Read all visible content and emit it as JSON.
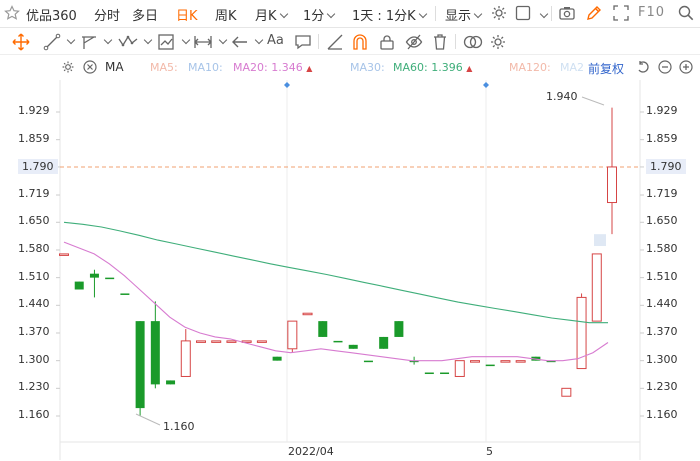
{
  "toolbar": {
    "stock_name": "优品360",
    "tabs": [
      "分时",
      "多日",
      "日K",
      "周K",
      "月K"
    ],
    "active_tab": "日K",
    "period": "1分",
    "range": "1天 : 1分K",
    "display": "显示",
    "f10": "F10"
  },
  "ma_legend": {
    "label": "MA",
    "ma5": "MA5:",
    "ma10": "MA10:",
    "ma20": "MA20: 1.346",
    "ma30": "MA30:",
    "ma60": "MA60: 1.396",
    "ma120": "MA120:",
    "ma250": "MA2",
    "adjust": "前复权"
  },
  "colors": {
    "up": "#d64545",
    "down": "#1a9a2a",
    "ma20": "#d77bd0",
    "ma60": "#3fae7a",
    "ma_faded": "#f2b9a9",
    "ma_blue": "#a7c4e8",
    "accent": "#ff6a00"
  },
  "chart_data": {
    "type": "candlestick",
    "y_ticks": [
      "1.929",
      "1.859",
      "1.790",
      "1.719",
      "1.650",
      "1.580",
      "1.510",
      "1.440",
      "1.370",
      "1.300",
      "1.230",
      "1.160"
    ],
    "current_price": "1.790",
    "ylim": [
      1.12,
      1.97
    ],
    "x_labels": [
      "2022/04",
      "5"
    ],
    "max_label": "1.940",
    "min_label": "1.160",
    "candles": [
      {
        "o": 1.57,
        "h": 1.57,
        "l": 1.57,
        "c": 1.57,
        "dir": "up"
      },
      {
        "o": 1.5,
        "h": 1.5,
        "l": 1.48,
        "c": 1.48,
        "dir": "down"
      },
      {
        "o": 1.52,
        "h": 1.53,
        "l": 1.46,
        "c": 1.51,
        "dir": "down"
      },
      {
        "o": 1.51,
        "h": 1.51,
        "l": 1.51,
        "c": 1.51,
        "dir": "down"
      },
      {
        "o": 1.47,
        "h": 1.47,
        "l": 1.47,
        "c": 1.47,
        "dir": "down"
      },
      {
        "o": 1.4,
        "h": 1.4,
        "l": 1.16,
        "c": 1.18,
        "dir": "down"
      },
      {
        "o": 1.4,
        "h": 1.45,
        "l": 1.23,
        "c": 1.24,
        "dir": "down"
      },
      {
        "o": 1.25,
        "h": 1.25,
        "l": 1.24,
        "c": 1.24,
        "dir": "down"
      },
      {
        "o": 1.26,
        "h": 1.38,
        "l": 1.26,
        "c": 1.35,
        "dir": "up"
      },
      {
        "o": 1.35,
        "h": 1.35,
        "l": 1.35,
        "c": 1.35,
        "dir": "up"
      },
      {
        "o": 1.35,
        "h": 1.35,
        "l": 1.35,
        "c": 1.35,
        "dir": "up"
      },
      {
        "o": 1.35,
        "h": 1.35,
        "l": 1.35,
        "c": 1.35,
        "dir": "up"
      },
      {
        "o": 1.35,
        "h": 1.35,
        "l": 1.35,
        "c": 1.35,
        "dir": "up"
      },
      {
        "o": 1.35,
        "h": 1.35,
        "l": 1.35,
        "c": 1.35,
        "dir": "up"
      },
      {
        "o": 1.31,
        "h": 1.31,
        "l": 1.3,
        "c": 1.3,
        "dir": "down"
      },
      {
        "o": 1.33,
        "h": 1.4,
        "l": 1.32,
        "c": 1.4,
        "dir": "up"
      },
      {
        "o": 1.42,
        "h": 1.42,
        "l": 1.42,
        "c": 1.42,
        "dir": "up"
      },
      {
        "o": 1.4,
        "h": 1.4,
        "l": 1.36,
        "c": 1.36,
        "dir": "down"
      },
      {
        "o": 1.35,
        "h": 1.35,
        "l": 1.35,
        "c": 1.35,
        "dir": "down"
      },
      {
        "o": 1.34,
        "h": 1.34,
        "l": 1.33,
        "c": 1.33,
        "dir": "down"
      },
      {
        "o": 1.3,
        "h": 1.3,
        "l": 1.3,
        "c": 1.3,
        "dir": "down"
      },
      {
        "o": 1.36,
        "h": 1.36,
        "l": 1.33,
        "c": 1.33,
        "dir": "down"
      },
      {
        "o": 1.4,
        "h": 1.4,
        "l": 1.36,
        "c": 1.36,
        "dir": "down"
      },
      {
        "o": 1.3,
        "h": 1.31,
        "l": 1.29,
        "c": 1.3,
        "dir": "down"
      },
      {
        "o": 1.27,
        "h": 1.27,
        "l": 1.27,
        "c": 1.27,
        "dir": "down"
      },
      {
        "o": 1.27,
        "h": 1.27,
        "l": 1.27,
        "c": 1.27,
        "dir": "down"
      },
      {
        "o": 1.26,
        "h": 1.3,
        "l": 1.26,
        "c": 1.3,
        "dir": "up"
      },
      {
        "o": 1.3,
        "h": 1.3,
        "l": 1.3,
        "c": 1.3,
        "dir": "up"
      },
      {
        "o": 1.29,
        "h": 1.29,
        "l": 1.29,
        "c": 1.29,
        "dir": "down"
      },
      {
        "o": 1.3,
        "h": 1.3,
        "l": 1.3,
        "c": 1.3,
        "dir": "up"
      },
      {
        "o": 1.3,
        "h": 1.3,
        "l": 1.3,
        "c": 1.3,
        "dir": "up"
      },
      {
        "o": 1.31,
        "h": 1.31,
        "l": 1.3,
        "c": 1.3,
        "dir": "down"
      },
      {
        "o": 1.3,
        "h": 1.3,
        "l": 1.3,
        "c": 1.3,
        "dir": "down"
      },
      {
        "o": 1.21,
        "h": 1.23,
        "l": 1.21,
        "c": 1.23,
        "dir": "up"
      },
      {
        "o": 1.28,
        "h": 1.47,
        "l": 1.28,
        "c": 1.46,
        "dir": "up"
      },
      {
        "o": 1.4,
        "h": 1.57,
        "l": 1.4,
        "c": 1.57,
        "dir": "up"
      },
      {
        "o": 1.7,
        "h": 1.94,
        "l": 1.62,
        "c": 1.79,
        "dir": "up"
      }
    ],
    "ma20": [
      1.6,
      1.585,
      1.57,
      1.545,
      1.515,
      1.48,
      1.445,
      1.41,
      1.385,
      1.37,
      1.36,
      1.355,
      1.345,
      1.335,
      1.325,
      1.32,
      1.325,
      1.33,
      1.325,
      1.32,
      1.315,
      1.31,
      1.305,
      1.3,
      1.3,
      1.3,
      1.305,
      1.31,
      1.31,
      1.31,
      1.31,
      1.305,
      1.3,
      1.3,
      1.305,
      1.32,
      1.346
    ],
    "ma60": [
      1.65,
      1.645,
      1.638,
      1.628,
      1.617,
      1.605,
      1.595,
      1.585,
      1.575,
      1.565,
      1.555,
      1.545,
      1.536,
      1.527,
      1.518,
      1.508,
      1.498,
      1.488,
      1.478,
      1.468,
      1.458,
      1.448,
      1.44,
      1.432,
      1.424,
      1.416,
      1.408,
      1.402,
      1.396,
      1.396
    ]
  }
}
